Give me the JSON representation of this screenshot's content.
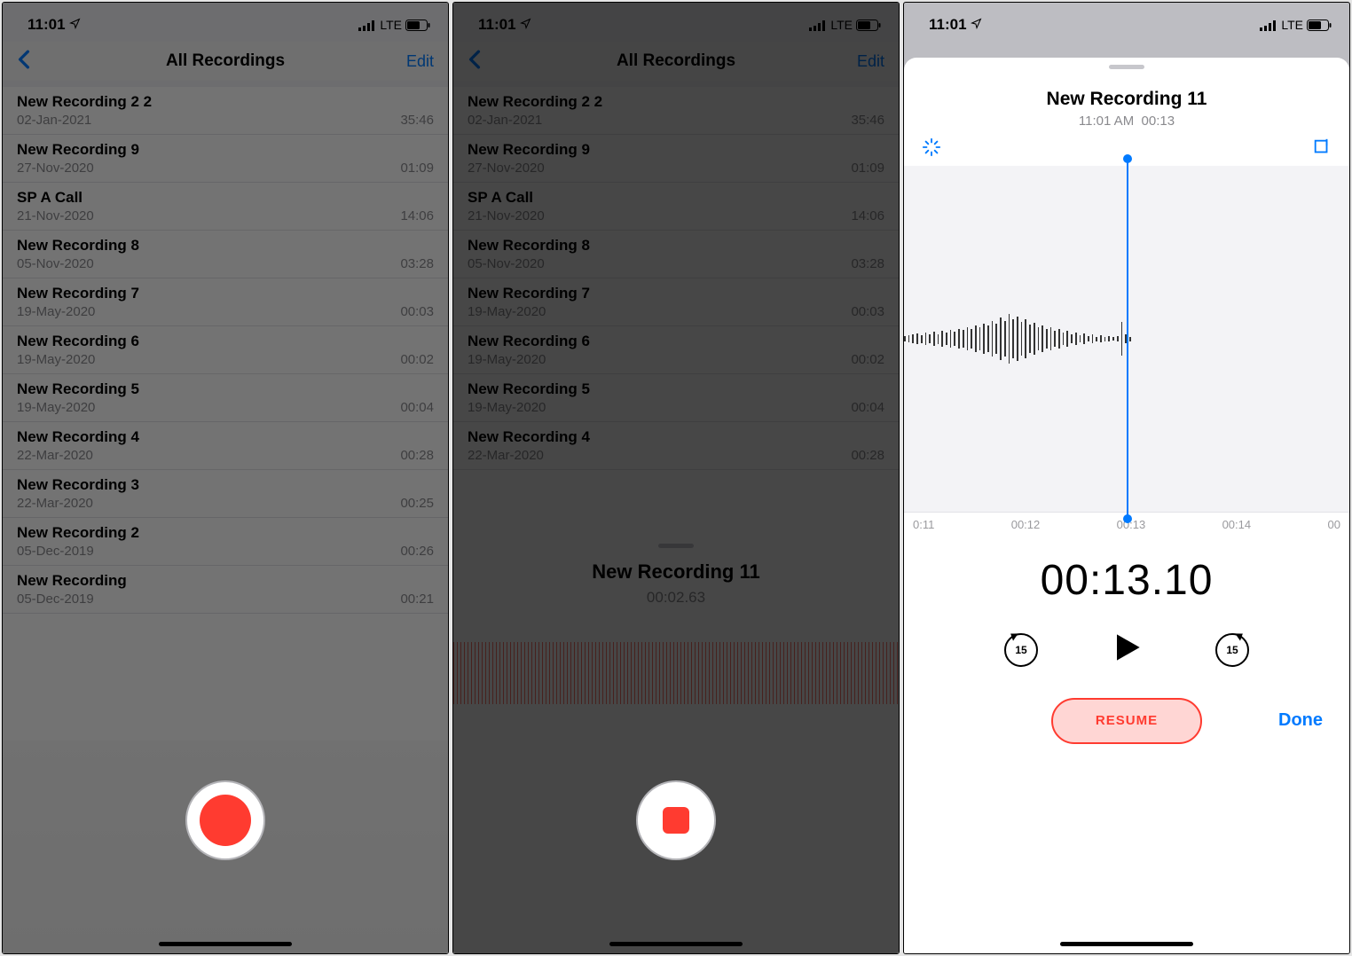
{
  "status": {
    "time": "11:01",
    "network_label": "LTE"
  },
  "nav": {
    "title": "All Recordings",
    "edit": "Edit"
  },
  "recordings": [
    {
      "title": "New Recording 2 2",
      "date": "02-Jan-2021",
      "dur": "35:46"
    },
    {
      "title": "New Recording 9",
      "date": "27-Nov-2020",
      "dur": "01:09"
    },
    {
      "title": "SP A Call",
      "date": "21-Nov-2020",
      "dur": "14:06"
    },
    {
      "title": "New Recording 8",
      "date": "05-Nov-2020",
      "dur": "03:28"
    },
    {
      "title": "New Recording 7",
      "date": "19-May-2020",
      "dur": "00:03"
    },
    {
      "title": "New Recording 6",
      "date": "19-May-2020",
      "dur": "00:02"
    },
    {
      "title": "New Recording 5",
      "date": "19-May-2020",
      "dur": "00:04"
    },
    {
      "title": "New Recording 4",
      "date": "22-Mar-2020",
      "dur": "00:28"
    },
    {
      "title": "New Recording 3",
      "date": "22-Mar-2020",
      "dur": "00:25"
    },
    {
      "title": "New Recording 2",
      "date": "05-Dec-2019",
      "dur": "00:26"
    },
    {
      "title": "New Recording",
      "date": "05-Dec-2019",
      "dur": "00:21"
    }
  ],
  "screen2": {
    "title": "New Recording 11",
    "timer": "00:02.63"
  },
  "screen3": {
    "title": "New Recording 11",
    "time_of_day": "11:01 AM",
    "duration_short": "00:13",
    "scale": [
      "0:11",
      "00:12",
      "00:13",
      "00:14",
      "00"
    ],
    "big_timer": "00:13.10",
    "skip_value": "15",
    "resume": "RESUME",
    "done": "Done"
  }
}
